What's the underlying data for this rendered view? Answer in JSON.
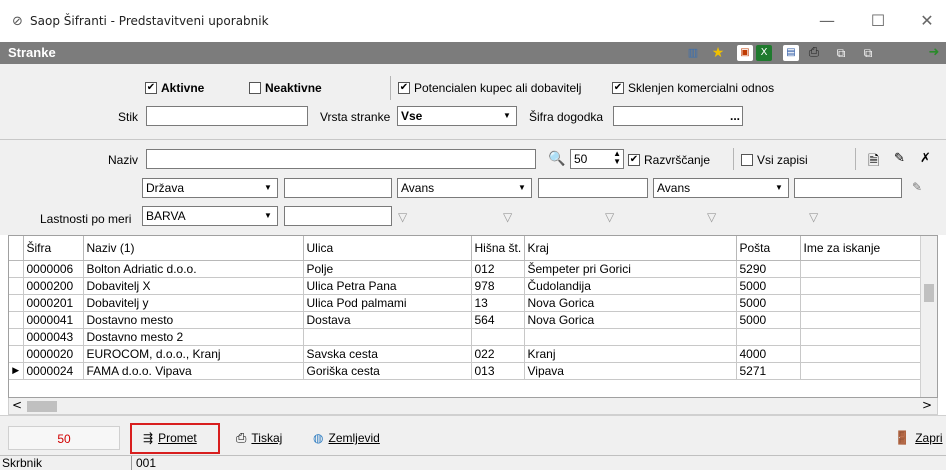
{
  "window": {
    "app_icon": "⊘",
    "title": "Saop Šifranti - Predstavitveni uporabnik",
    "minimize": "—",
    "maximize": "☐",
    "close": "✕"
  },
  "header": {
    "title": "Stranke",
    "toolbar_icons": [
      "layout-icon",
      "star-icon",
      "export-icon",
      "excel-icon",
      "chart-icon",
      "print-icon",
      "copy-icon",
      "paste-icon",
      "exit-icon"
    ]
  },
  "filters": {
    "aktivne_label": "Aktivne",
    "aktivne_checked": true,
    "neaktivne_label": "Neaktivne",
    "neaktivne_checked": false,
    "potencialen_label": "Potencialen kupec ali dobavitelj",
    "potencialen_checked": true,
    "sklenjen_label": "Sklenjen komercialni odnos",
    "sklenjen_checked": true,
    "stik_label": "Stik",
    "stik_value": "",
    "vrsta_label": "Vrsta stranke",
    "vrsta_value": "Vse",
    "sifra_dogodka_label": "Šifra dogodka",
    "sifra_dogodka_value": "",
    "sifra_dogodka_btn": "...",
    "naziv_label": "Naziv",
    "naziv_value": "",
    "limit_value": "50",
    "razvrscanje_label": "Razvrščanje",
    "razvrscanje_checked": true,
    "vsi_zapisi_label": "Vsi zapisi",
    "vsi_zapisi_checked": false,
    "drzava_value": "Država",
    "avans1_value": "Avans",
    "avans2_value": "Avans",
    "lastnosti_label": "Lastnosti po meri",
    "barva_value": "BARVA"
  },
  "grid": {
    "columns": [
      "",
      "Šifra",
      "Naziv (1)",
      "Ulica",
      "Hišna št.",
      "Kraj",
      "Pošta",
      "Ime za iskanje"
    ],
    "rows": [
      [
        "",
        "0000006",
        "Bolton Adriatic d.o.o.",
        "Polje",
        "012",
        "Šempeter pri Gorici",
        "5290",
        ""
      ],
      [
        "",
        "0000200",
        "Dobavitelj X",
        "Ulica Petra Pana",
        "978",
        "Čudolandija",
        "5000",
        ""
      ],
      [
        "",
        "0000201",
        "Dobavitelj y",
        "Ulica Pod palmami",
        "13",
        "Nova Gorica",
        "5000",
        ""
      ],
      [
        "",
        "0000041",
        "Dostavno mesto",
        "Dostava",
        "564",
        "Nova Gorica",
        "5000",
        ""
      ],
      [
        "",
        "0000043",
        "Dostavno mesto 2",
        "",
        "",
        "",
        "",
        ""
      ],
      [
        "",
        "0000020",
        "EUROCOM, d.o.o., Kranj",
        "Savska cesta",
        "022",
        "Kranj",
        "4000",
        ""
      ],
      [
        "▶",
        "0000024",
        "FAMA d.o.o. Vipava",
        "Goriška cesta",
        "013",
        "Vipava",
        "5271",
        ""
      ]
    ],
    "scroll_left": "<",
    "scroll_right": ">"
  },
  "bottom": {
    "count": "50",
    "promet_label": "Promet",
    "tiskaj_label": "Tiskaj",
    "zemljevid_label": "Zemljevid",
    "zapri_label": "Zapri"
  },
  "status": {
    "label": "Skrbnik",
    "value": "001"
  },
  "colors": {
    "header_bg": "#7c7c7c",
    "count_text": "#d00000",
    "highlight": "#d81e1e"
  }
}
